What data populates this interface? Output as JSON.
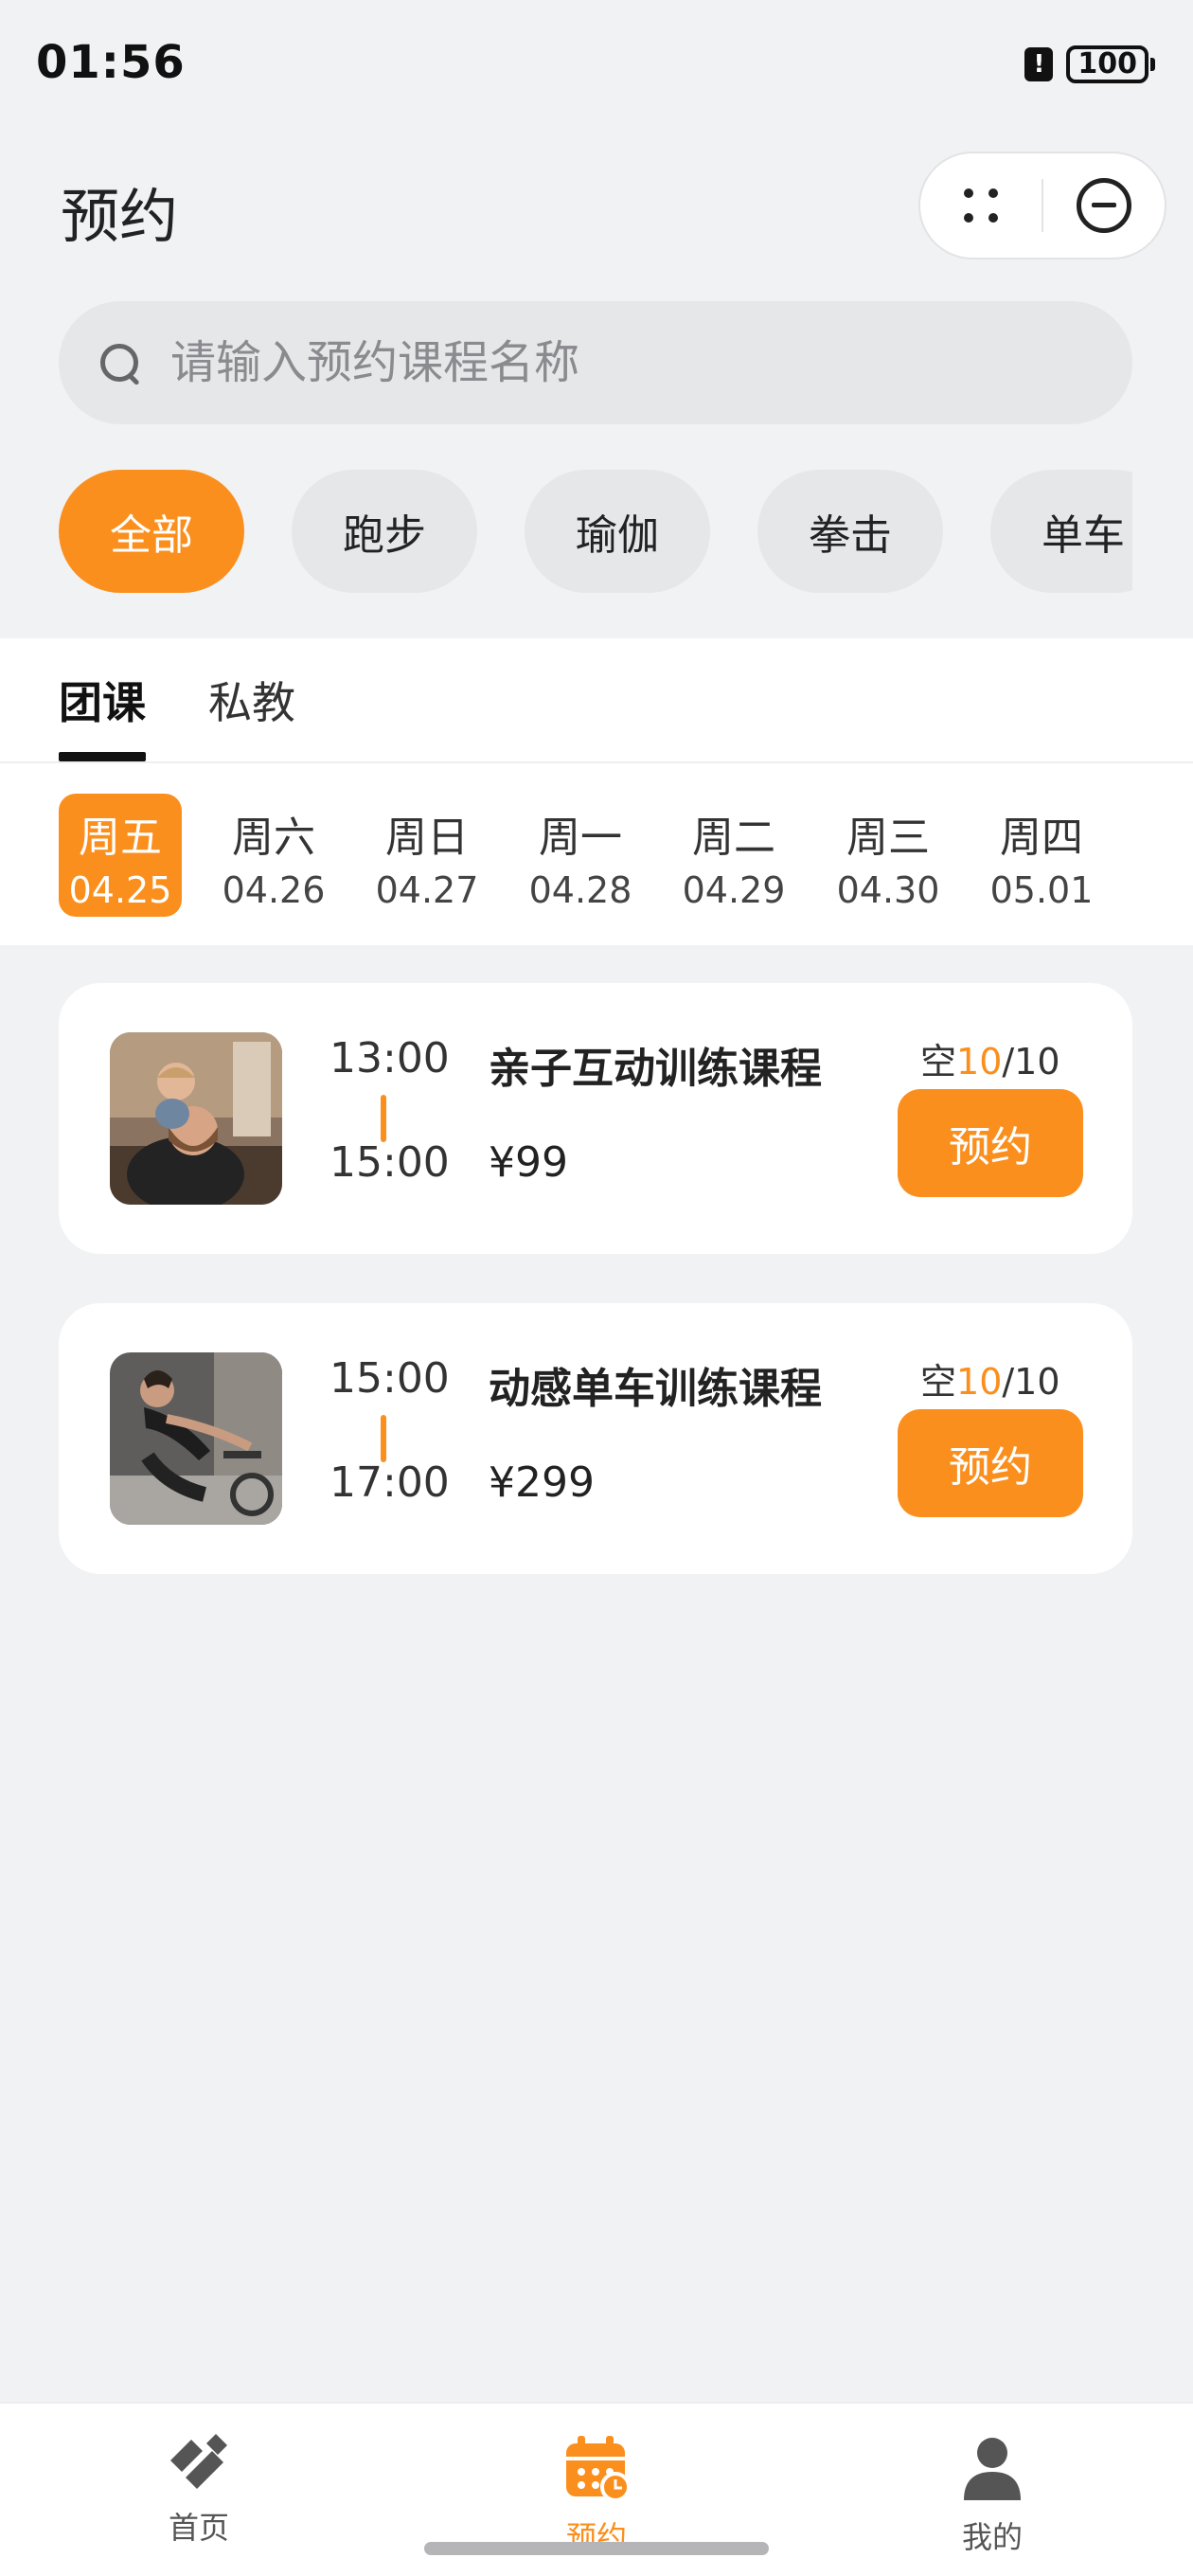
{
  "status_bar": {
    "time": "01:56",
    "battery": "100"
  },
  "header": {
    "title": "预约"
  },
  "search": {
    "placeholder": "请输入预约课程名称"
  },
  "categories": [
    {
      "label": "全部",
      "active": true
    },
    {
      "label": "跑步"
    },
    {
      "label": "瑜伽"
    },
    {
      "label": "拳击"
    },
    {
      "label": "单车"
    }
  ],
  "tabs": [
    {
      "label": "团课",
      "active": true
    },
    {
      "label": "私教"
    }
  ],
  "dates": [
    {
      "day": "周五",
      "date": "04.25",
      "active": true
    },
    {
      "day": "周六",
      "date": "04.26"
    },
    {
      "day": "周日",
      "date": "04.27"
    },
    {
      "day": "周一",
      "date": "04.28"
    },
    {
      "day": "周二",
      "date": "04.29"
    },
    {
      "day": "周三",
      "date": "04.30"
    },
    {
      "day": "周四",
      "date": "05.01"
    }
  ],
  "courses": [
    {
      "start": "13:00",
      "end": "15:00",
      "name": "亲子互动训练课程",
      "price": "¥99",
      "capacity_prefix": "空",
      "available": "10",
      "capacity_suffix": "/10",
      "button": "预约"
    },
    {
      "start": "15:00",
      "end": "17:00",
      "name": "动感单车训练课程",
      "price": "¥299",
      "capacity_prefix": "空",
      "available": "10",
      "capacity_suffix": "/10",
      "button": "预约"
    }
  ],
  "tabbar": [
    {
      "label": "首页",
      "icon": "home-logo-icon"
    },
    {
      "label": "预约",
      "icon": "calendar-icon",
      "active": true
    },
    {
      "label": "我的",
      "icon": "user-icon"
    }
  ],
  "colors": {
    "accent": "#fb8f1d",
    "background": "#f1f2f4"
  }
}
